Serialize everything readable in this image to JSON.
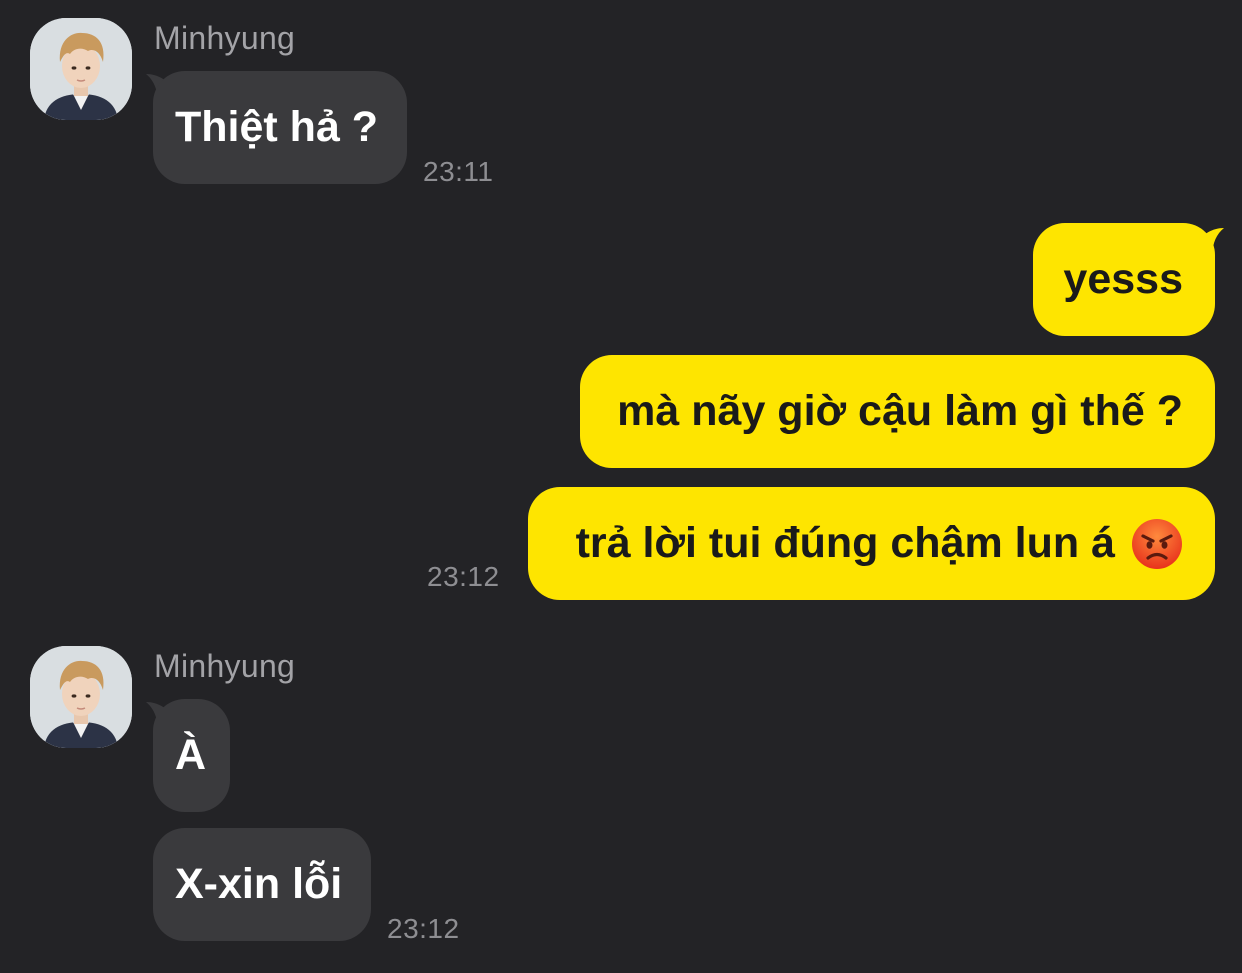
{
  "messages": [
    {
      "sender": "Minhyung",
      "direction": "incoming",
      "bubbles": [
        "Thiệt hả ?"
      ],
      "time": "23:11"
    },
    {
      "direction": "outgoing",
      "bubbles": [
        "yesss",
        "mà nãy giờ cậu làm gì thế ?",
        "trả lời tui đúng chậm lun á"
      ],
      "trailing_emoji": "angry-face-icon",
      "time": "23:12"
    },
    {
      "sender": "Minhyung",
      "direction": "incoming",
      "bubbles": [
        "À",
        "X-xin lỗi"
      ],
      "time": "23:12"
    }
  ],
  "colors": {
    "background": "#232326",
    "incoming_bubble": "#3a3a3d",
    "outgoing_bubble": "#fee500",
    "name_text": "#a3a3a7",
    "time_text": "#8e8e92"
  }
}
